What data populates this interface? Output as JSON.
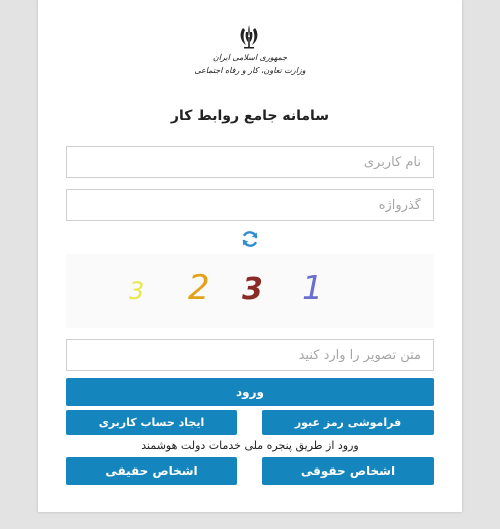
{
  "logo": {
    "line1": "جمهوری اسلامی ایران",
    "line2": "وزارت تعاون، کار و رفاه اجتماعی"
  },
  "title": "سامانه جامع روابط کار",
  "form": {
    "username_placeholder": "نام کاربری",
    "password_placeholder": "گذرواژه",
    "captcha_placeholder": "متن تصویر را وارد کنید",
    "captcha_digits": [
      "3",
      "2",
      "3",
      "1"
    ]
  },
  "buttons": {
    "login": "ورود",
    "forgot_password": "فراموشی رمز عبور",
    "create_account": "ایجاد حساب کاربری",
    "natural_persons": "اشخاص حقوقی",
    "legal_persons": "اشخاص حقیقی"
  },
  "smart_window_note": "ورود از طریق پنجره ملی خدمات دولت هوشمند",
  "colors": {
    "primary": "#1585bd",
    "refresh": "#2e8ed1"
  }
}
